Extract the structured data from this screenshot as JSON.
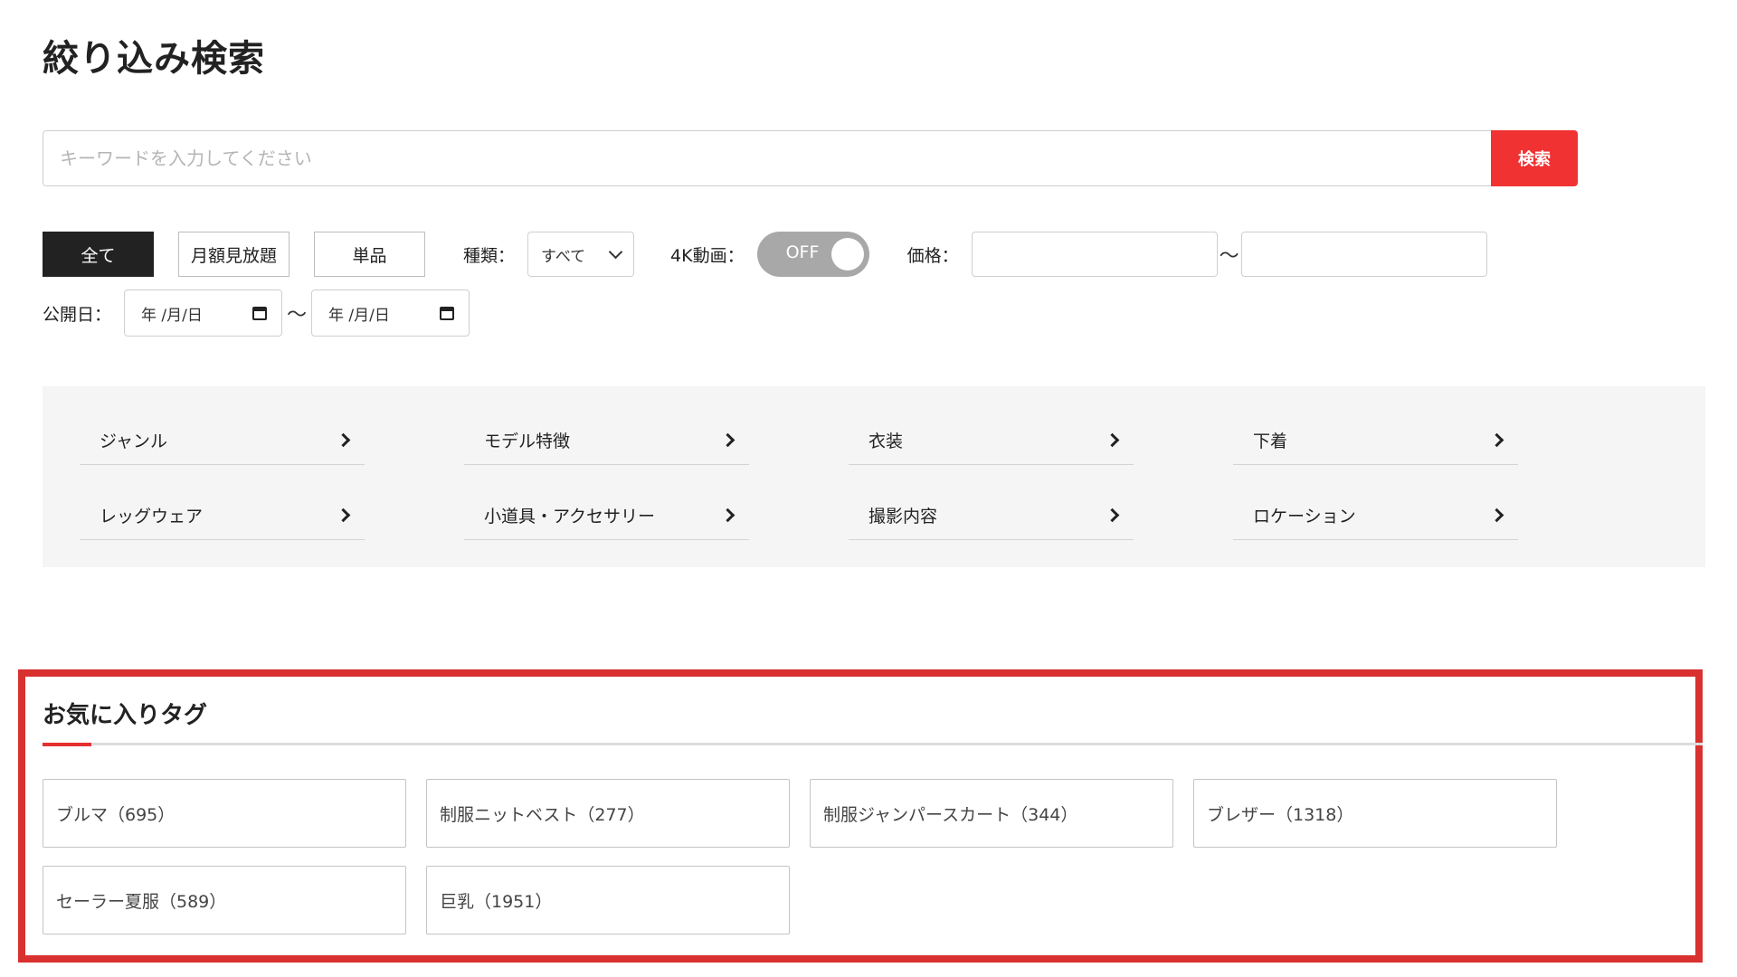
{
  "page_title": "絞り込み検索",
  "search": {
    "placeholder": "キーワードを入力してください",
    "button_label": "検索"
  },
  "filters": {
    "plan_buttons": [
      "全て",
      "月額見放題",
      "単品"
    ],
    "active_plan": "全て",
    "type_label": "種類：",
    "type_value": "すべて",
    "fourk_label": "4K動画：",
    "fourk_toggle": "OFF",
    "price_label": "価格：",
    "tilde": "〜",
    "release_label": "公開日：",
    "date_placeholder": "年 /月/日"
  },
  "categories": [
    "ジャンル",
    "モデル特徴",
    "衣装",
    "下着",
    "レッグウェア",
    "小道具・アクセサリー",
    "撮影内容",
    "ロケーション"
  ],
  "favorites": {
    "title": "お気に入りタグ",
    "tags": [
      "ブルマ（695）",
      "制服ニットベスト（277）",
      "制服ジャンパースカート（344）",
      "ブレザー（1318）",
      "セーラー夏服（589）",
      "巨乳（1951）"
    ]
  },
  "colors": {
    "accent_red": "#f03232",
    "highlight_border": "#d93030",
    "active_button": "#222222",
    "toggle_off": "#a8a8a8",
    "panel_bg": "#f5f5f5"
  },
  "icons": {
    "select": "chevron-down-icon",
    "category": "chevron-right-icon",
    "date": "calendar-icon"
  }
}
